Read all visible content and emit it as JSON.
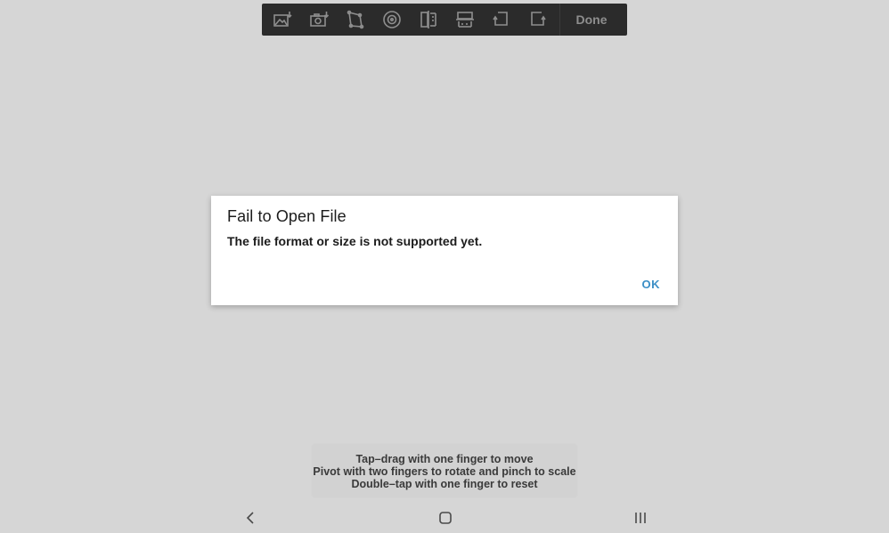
{
  "toolbar": {
    "tools": [
      {
        "name": "image-import-icon"
      },
      {
        "name": "camera-import-icon"
      },
      {
        "name": "perspective-crop-icon"
      },
      {
        "name": "target-icon"
      },
      {
        "name": "flip-horizontal-icon"
      },
      {
        "name": "flip-vertical-icon"
      },
      {
        "name": "rotate-left-icon"
      },
      {
        "name": "rotate-right-icon"
      }
    ],
    "done_label": "Done"
  },
  "dialog": {
    "title": "Fail to Open File",
    "message": "The file format or size is not supported yet.",
    "ok_label": "OK"
  },
  "hint": {
    "line1": "Tap–drag with one finger to move",
    "line2": "Pivot with two fingers to rotate and pinch to scale",
    "line3": "Double–tap with one finger to reset"
  },
  "navbar": {
    "back": "back-icon",
    "home": "home-icon",
    "recents": "recents-icon"
  }
}
